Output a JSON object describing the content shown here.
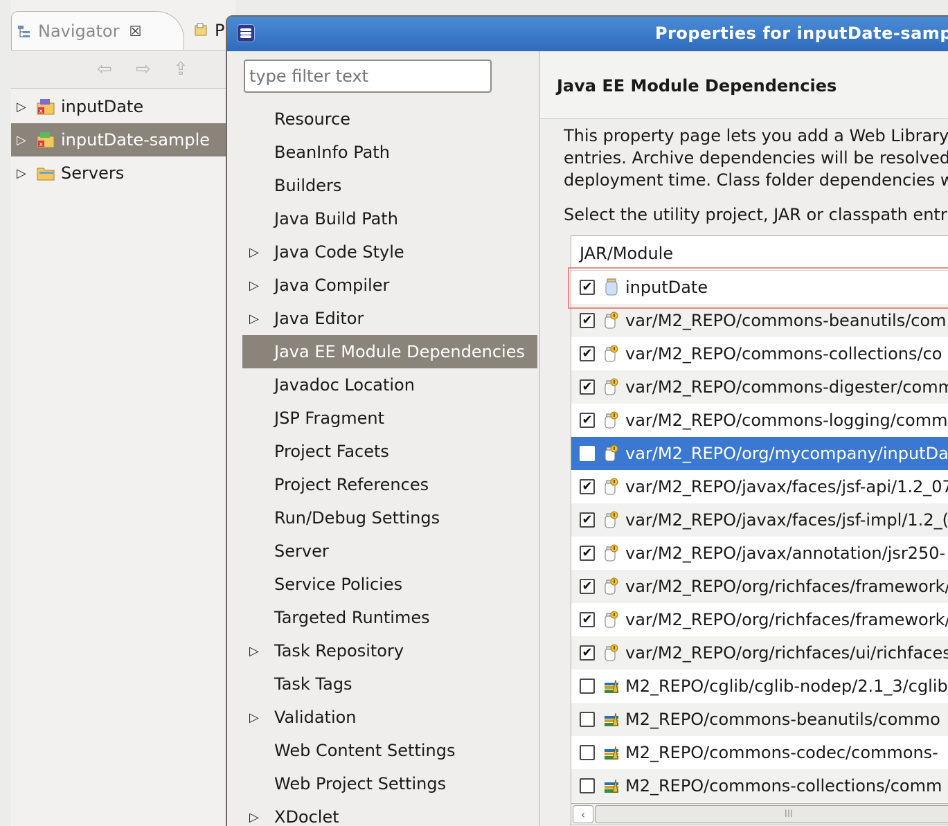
{
  "navigator": {
    "tab_label": "Navigator",
    "tab_close": "☒",
    "other_tab_label": "Pr",
    "projects": [
      {
        "label": "inputDate",
        "selected": false
      },
      {
        "label": "inputDate-sample",
        "selected": true
      },
      {
        "label": "Servers",
        "selected": false
      }
    ]
  },
  "dialog": {
    "title": "Properties for inputDate-samp",
    "filter_placeholder": "type filter text",
    "filter_value": "type filter text",
    "categories": [
      {
        "label": "Resource",
        "expandable": false
      },
      {
        "label": "BeanInfo Path",
        "expandable": false
      },
      {
        "label": "Builders",
        "expandable": false
      },
      {
        "label": "Java Build Path",
        "expandable": false
      },
      {
        "label": "Java Code Style",
        "expandable": true
      },
      {
        "label": "Java Compiler",
        "expandable": true
      },
      {
        "label": "Java Editor",
        "expandable": true
      },
      {
        "label": "Java EE Module Dependencies",
        "expandable": false,
        "selected": true
      },
      {
        "label": "Javadoc Location",
        "expandable": false
      },
      {
        "label": "JSP Fragment",
        "expandable": false
      },
      {
        "label": "Project Facets",
        "expandable": false
      },
      {
        "label": "Project References",
        "expandable": false
      },
      {
        "label": "Run/Debug Settings",
        "expandable": false
      },
      {
        "label": "Server",
        "expandable": false
      },
      {
        "label": "Service Policies",
        "expandable": false
      },
      {
        "label": "Targeted Runtimes",
        "expandable": false
      },
      {
        "label": "Task Repository",
        "expandable": true
      },
      {
        "label": "Task Tags",
        "expandable": false
      },
      {
        "label": "Validation",
        "expandable": true
      },
      {
        "label": "Web Content Settings",
        "expandable": false
      },
      {
        "label": "Web Project Settings",
        "expandable": false
      },
      {
        "label": "XDoclet",
        "expandable": true
      }
    ],
    "page": {
      "title": "Java EE Module Dependencies",
      "description_lines": [
        "This property page lets you add a Web Library",
        "entries. Archive dependencies will be resolved",
        "deployment time. Class folder dependencies w"
      ],
      "select_label": "Select the utility project, JAR or classpath entr",
      "column_header": "JAR/Module",
      "rows": [
        {
          "label": "inputDate",
          "checked": true,
          "icon": "project-jar-icon"
        },
        {
          "label": "var/M2_REPO/commons-beanutils/com",
          "checked": true,
          "icon": "variable-jar-icon"
        },
        {
          "label": "var/M2_REPO/commons-collections/co",
          "checked": true,
          "icon": "variable-jar-icon"
        },
        {
          "label": "var/M2_REPO/commons-digester/comm",
          "checked": true,
          "icon": "variable-jar-icon"
        },
        {
          "label": "var/M2_REPO/commons-logging/comm",
          "checked": true,
          "icon": "variable-jar-icon"
        },
        {
          "label": "var/M2_REPO/org/mycompany/inputDa",
          "checked": false,
          "icon": "variable-jar-icon",
          "selected": true
        },
        {
          "label": "var/M2_REPO/javax/faces/jsf-api/1.2_07",
          "checked": true,
          "icon": "variable-jar-icon"
        },
        {
          "label": "var/M2_REPO/javax/faces/jsf-impl/1.2_(",
          "checked": true,
          "icon": "variable-jar-icon"
        },
        {
          "label": "var/M2_REPO/javax/annotation/jsr250-",
          "checked": true,
          "icon": "variable-jar-icon"
        },
        {
          "label": "var/M2_REPO/org/richfaces/framework/",
          "checked": true,
          "icon": "variable-jar-icon"
        },
        {
          "label": "var/M2_REPO/org/richfaces/framework/",
          "checked": true,
          "icon": "variable-jar-icon"
        },
        {
          "label": "var/M2_REPO/org/richfaces/ui/richfaces",
          "checked": true,
          "icon": "variable-jar-icon"
        },
        {
          "label": "M2_REPO/cglib/cglib-nodep/2.1_3/cglib",
          "checked": false,
          "icon": "library-icon"
        },
        {
          "label": "M2_REPO/commons-beanutils/commo",
          "checked": false,
          "icon": "library-icon"
        },
        {
          "label": "M2_REPO/commons-codec/commons-",
          "checked": false,
          "icon": "library-icon"
        },
        {
          "label": "M2_REPO/commons-collections/comm",
          "checked": false,
          "icon": "library-icon"
        }
      ],
      "scrollbar_grip": "III"
    }
  },
  "colors": {
    "selection_gray": "#8a847a",
    "selection_blue": "#3b78d1",
    "titlebar_blue": "#3a7bcc",
    "focus_red": "#e48a87"
  }
}
